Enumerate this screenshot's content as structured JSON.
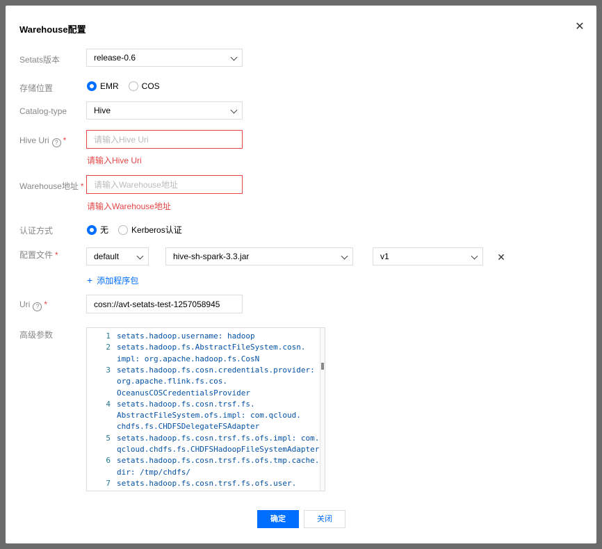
{
  "dialog": {
    "title": "Warehouse配置",
    "close_icon": "close-icon"
  },
  "fields": {
    "setats_version": {
      "label": "Setats版本",
      "value": "release-0.6"
    },
    "storage_location": {
      "label": "存储位置",
      "options": [
        "EMR",
        "COS"
      ],
      "selected": "EMR"
    },
    "catalog_type": {
      "label": "Catalog-type",
      "value": "Hive"
    },
    "hive_uri": {
      "label": "Hive Uri",
      "placeholder": "请输入Hive Uri",
      "error": "请输入Hive Uri",
      "required": "*",
      "help": "?"
    },
    "warehouse_address": {
      "label": "Warehouse地址",
      "placeholder": "请输入Warehouse地址",
      "error": "请输入Warehouse地址",
      "required": "*"
    },
    "auth_method": {
      "label": "认证方式",
      "options": [
        "无",
        "Kerberos认证"
      ],
      "selected": "无"
    },
    "config_file": {
      "label": "配置文件",
      "required": "*",
      "env": "default",
      "jar": "hive-sh-spark-3.3.jar",
      "version": "v1",
      "add_label": "添加程序包",
      "add_icon": "plus-icon"
    },
    "uri": {
      "label": "Uri",
      "value": "cosn://avt-setats-test-1257058945",
      "required": "*",
      "help": "?"
    },
    "advanced_params": {
      "label": "高级参数",
      "lines": [
        {
          "num": "1",
          "text": [
            "setats.hadoop.username: hadoop"
          ]
        },
        {
          "num": "2",
          "text": [
            "setats.hadoop.fs.AbstractFileSystem.cosn.",
            "impl: org.apache.hadoop.fs.CosN"
          ]
        },
        {
          "num": "3",
          "text": [
            "setats.hadoop.fs.cosn.credentials.provider:",
            "org.apache.flink.fs.cos.",
            "OceanusCOSCredentialsProvider"
          ]
        },
        {
          "num": "4",
          "text": [
            "setats.hadoop.fs.cosn.trsf.fs.",
            "AbstractFileSystem.ofs.impl: com.qcloud.",
            "chdfs.fs.CHDFSDelegateFSAdapter"
          ]
        },
        {
          "num": "5",
          "text": [
            "setats.hadoop.fs.cosn.trsf.fs.ofs.impl: com.",
            "qcloud.chdfs.fs.CHDFSHadoopFileSystemAdapter"
          ]
        },
        {
          "num": "6",
          "text": [
            "setats.hadoop.fs.cosn.trsf.fs.ofs.tmp.cache.",
            "dir: /tmp/chdfs/"
          ]
        },
        {
          "num": "7",
          "text": [
            "setats.hadoop.fs.cosn.trsf.fs.ofs.user."
          ]
        }
      ]
    }
  },
  "footer": {
    "confirm": "确定",
    "close": "关闭"
  }
}
